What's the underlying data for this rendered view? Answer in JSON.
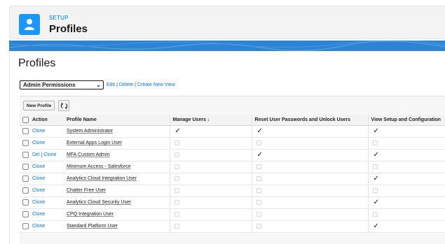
{
  "header": {
    "setup_label": "SETUP",
    "title": "Profiles"
  },
  "section_title": "Profiles",
  "view": {
    "selected": "Admin Permissions",
    "links": {
      "edit": "Edit",
      "delete": "Delete",
      "create": "Create New View"
    }
  },
  "toolbar": {
    "new_profile": "New Profile"
  },
  "table": {
    "columns": {
      "action": "Action",
      "profile_name": "Profile Name",
      "manage_users": "Manage Users",
      "manage_users_sort": "↓",
      "reset_passwords": "Reset User Passwords and Unlock Users",
      "view_setup": "View Setup and Configuration"
    },
    "rows": [
      {
        "actions": [
          "Clone"
        ],
        "name": "System Administrator",
        "manage_users": true,
        "reset_passwords": true,
        "view_setup": true
      },
      {
        "actions": [
          "Clone"
        ],
        "name": "External Apps Login User",
        "manage_users": false,
        "reset_passwords": false,
        "view_setup": false
      },
      {
        "actions": [
          "Del",
          "Clone"
        ],
        "name": "MFA Custom Admin",
        "manage_users": false,
        "reset_passwords": true,
        "view_setup": true
      },
      {
        "actions": [
          "Clone"
        ],
        "name": "Minimum Access - Salesforce",
        "manage_users": false,
        "reset_passwords": false,
        "view_setup": false
      },
      {
        "actions": [
          "Clone"
        ],
        "name": "Analytics Cloud Integration User",
        "manage_users": false,
        "reset_passwords": false,
        "view_setup": true
      },
      {
        "actions": [
          "Clone"
        ],
        "name": "Chatter Free User",
        "manage_users": false,
        "reset_passwords": false,
        "view_setup": false
      },
      {
        "actions": [
          "Clone"
        ],
        "name": "Analytics Cloud Security User",
        "manage_users": false,
        "reset_passwords": false,
        "view_setup": true
      },
      {
        "actions": [
          "Clone"
        ],
        "name": "CPQ Integration User",
        "manage_users": false,
        "reset_passwords": false,
        "view_setup": false
      },
      {
        "actions": [
          "Clone"
        ],
        "name": "Standard Platform User",
        "manage_users": false,
        "reset_passwords": false,
        "view_setup": true
      }
    ]
  },
  "icons": {
    "header": "user-icon",
    "refresh": "refresh-icon",
    "dropdown": "chevron-down-icon",
    "checked": "checkmark-icon"
  },
  "colors": {
    "brand": "#1b96ff",
    "link": "#0176d3",
    "banner": "#2e84d4"
  }
}
